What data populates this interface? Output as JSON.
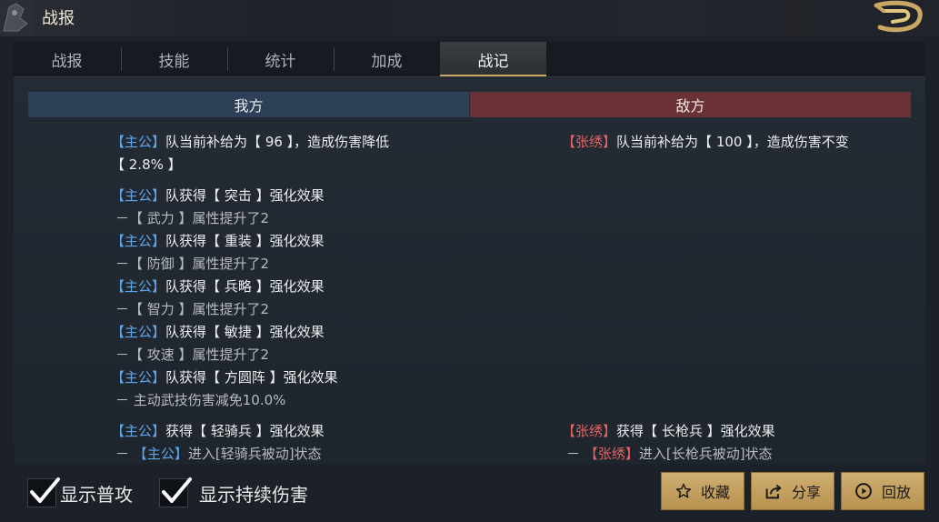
{
  "window": {
    "title": "战报"
  },
  "tabs": [
    {
      "label": "战报"
    },
    {
      "label": "技能"
    },
    {
      "label": "统计"
    },
    {
      "label": "加成"
    },
    {
      "label": "战记",
      "active": true
    }
  ],
  "columns": {
    "ours": "我方",
    "enemy": "敌方"
  },
  "log_left": {
    "l1a": {
      "b1": "【",
      "name": "主公",
      "b2": "】",
      "text": "队当前补给为【 96 】，造成伤害降低"
    },
    "l1b": "【 2.8% 】",
    "g1": {
      "b1": "【",
      "name": "主公",
      "b2": "】",
      "text": "队获得【 突击 】强化效果",
      "sub": "－【 武力 】属性提升了2"
    },
    "g2": {
      "b1": "【",
      "name": "主公",
      "b2": "】",
      "text": "队获得【 重装 】强化效果",
      "sub": "－【 防御 】属性提升了2"
    },
    "g3": {
      "b1": "【",
      "name": "主公",
      "b2": "】",
      "text": "队获得【 兵略 】强化效果",
      "sub": "－【 智力 】属性提升了2"
    },
    "g4": {
      "b1": "【",
      "name": "主公",
      "b2": "】",
      "text": "队获得【 敏捷 】强化效果",
      "sub": "－【 攻速 】属性提升了2"
    },
    "g5": {
      "b1": "【",
      "name": "主公",
      "b2": "】",
      "text": "队获得【 方圆阵 】强化效果",
      "sub": "－ 主动武技伤害减免10.0%"
    },
    "g6": {
      "b1": "【",
      "name": "主公",
      "b2": "】",
      "text": "获得【 轻骑兵 】强化效果",
      "sub_prefix": "－",
      "sub_b1": "【",
      "sub_name": "主公",
      "sub_b2": "】",
      "sub_text": "进入[轻骑兵被动]状态"
    }
  },
  "log_right": {
    "r1": {
      "b1": "【",
      "name": "张绣",
      "b2": "】",
      "text": "队当前补给为【 100 】，造成伤害不变"
    },
    "r2": {
      "b1": "【",
      "name": "张绣",
      "b2": "】",
      "text": "获得【 长枪兵 】强化效果",
      "sub_prefix": "－",
      "sub_b1": "【",
      "sub_name": "张绣",
      "sub_b2": "】",
      "sub_text": "进入[长枪兵被动]状态"
    }
  },
  "options": {
    "show_normal_attack": {
      "label": "显示普攻",
      "checked": true
    },
    "show_dot": {
      "label": "显示持续伤害",
      "checked": true
    }
  },
  "buttons": {
    "favorite": {
      "label": "收藏",
      "icon": "star-icon"
    },
    "share": {
      "label": "分享",
      "icon": "share-icon"
    },
    "replay": {
      "label": "回放",
      "icon": "play-icon"
    }
  },
  "colors": {
    "ally_name": "#5ea6ea",
    "enemy_name": "#e06464",
    "accent_gold": "#c9a864"
  }
}
